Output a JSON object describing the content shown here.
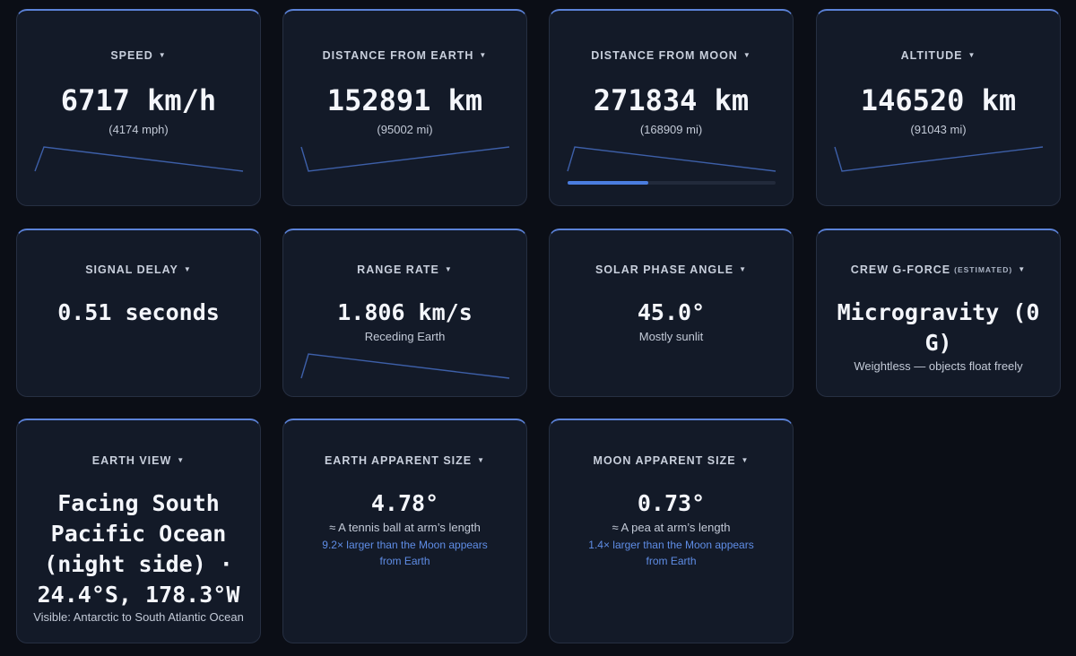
{
  "cards": {
    "speed": {
      "label": "SPEED",
      "value": "6717 km/h",
      "sub": "(4174 mph)"
    },
    "distance_earth": {
      "label": "DISTANCE FROM EARTH",
      "value": "152891 km",
      "sub": "(95002 mi)"
    },
    "distance_moon": {
      "label": "DISTANCE FROM MOON",
      "value": "271834 km",
      "sub": "(168909 mi)",
      "progress": 0.39
    },
    "altitude": {
      "label": "ALTITUDE",
      "value": "146520 km",
      "sub": "(91043 mi)"
    },
    "signal_delay": {
      "label": "SIGNAL DELAY",
      "value": "0.51 seconds"
    },
    "range_rate": {
      "label": "RANGE RATE",
      "value": "1.806 km/s",
      "sub": "Receding Earth"
    },
    "solar_phase": {
      "label": "SOLAR PHASE ANGLE",
      "value": "45.0°",
      "sub": "Mostly sunlit"
    },
    "crew_gforce": {
      "label": "CREW G-FORCE",
      "label_sub": "(ESTIMATED)",
      "value": "Microgravity (0 G)",
      "sub": "Weightless — objects float freely"
    },
    "earth_view": {
      "label": "EARTH VIEW",
      "value": "Facing South Pacific Ocean (night side) · 24.4°S, 178.3°W",
      "sub": "Visible: Antarctic to South Atlantic Ocean"
    },
    "earth_size": {
      "label": "EARTH APPARENT SIZE",
      "value": "4.78°",
      "sub": "≈ A tennis ball at arm’s length",
      "note": "9.2× larger than the Moon appears from Earth"
    },
    "moon_size": {
      "label": "MOON APPARENT SIZE",
      "value": "0.73°",
      "sub": "≈ A pea at arm’s length",
      "note": "1.4× larger than the Moon appears from Earth"
    }
  },
  "icons": {
    "caret": "caret-down-icon"
  },
  "colors": {
    "accent": "#5b82d8",
    "card_bg": "#131a28",
    "page_bg": "#0b0e16",
    "note": "#5f8de6"
  }
}
